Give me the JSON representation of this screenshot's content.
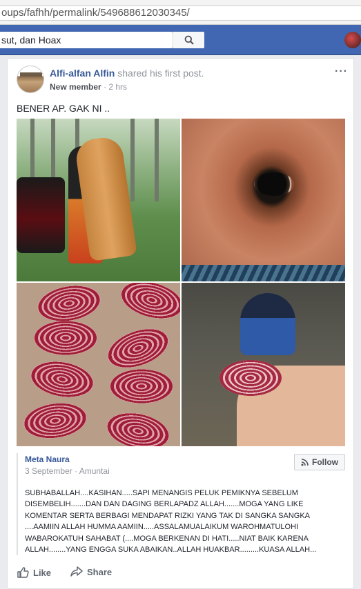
{
  "browser": {
    "url": "oups/fafhh/permalink/549688612030345/"
  },
  "topbar": {
    "search_value": "sut, dan Hoax",
    "search_icon": "search-icon",
    "avatar_icon": "profile-avatar-icon"
  },
  "post": {
    "author": "Alfi-alfan Alfin",
    "action": " shared his first post.",
    "badge": "New member",
    "time": " · 2 hrs",
    "menu": "···",
    "text": "BENER AP. GAK NI ..",
    "shared": {
      "author": "Meta Naura",
      "meta": "3 September · Amuntai",
      "follow_label": "Follow",
      "body": "SUBHABALLAH....KASIHAN.....SAPI MENANGIS PELUK PEMIKNYA SEBELUM DISEMBELIH.......DAN DAN DAGING BERLAPADZ ALLAH.......MOGA YANG LIKE KOMENTAR SERTA BERBAGI MENDAPAT RIZKI YANG TAK DI SANGKA SANGKA ....AAMIIN ALLAH HUMMA AAMIIN.....ASSALAMUALAIKUM WAROHMATULOHI WABAROKATUH SAHABAT (....MOGA BERKENAN DI HATI.....NIAT BAIK KARENA ALLAH........YANG ENGGA SUKA ABAIKAN..ALLAH HUAKBAR.........KUASA ALLAH..."
    },
    "actions": {
      "like": "Like",
      "share": "Share"
    }
  }
}
